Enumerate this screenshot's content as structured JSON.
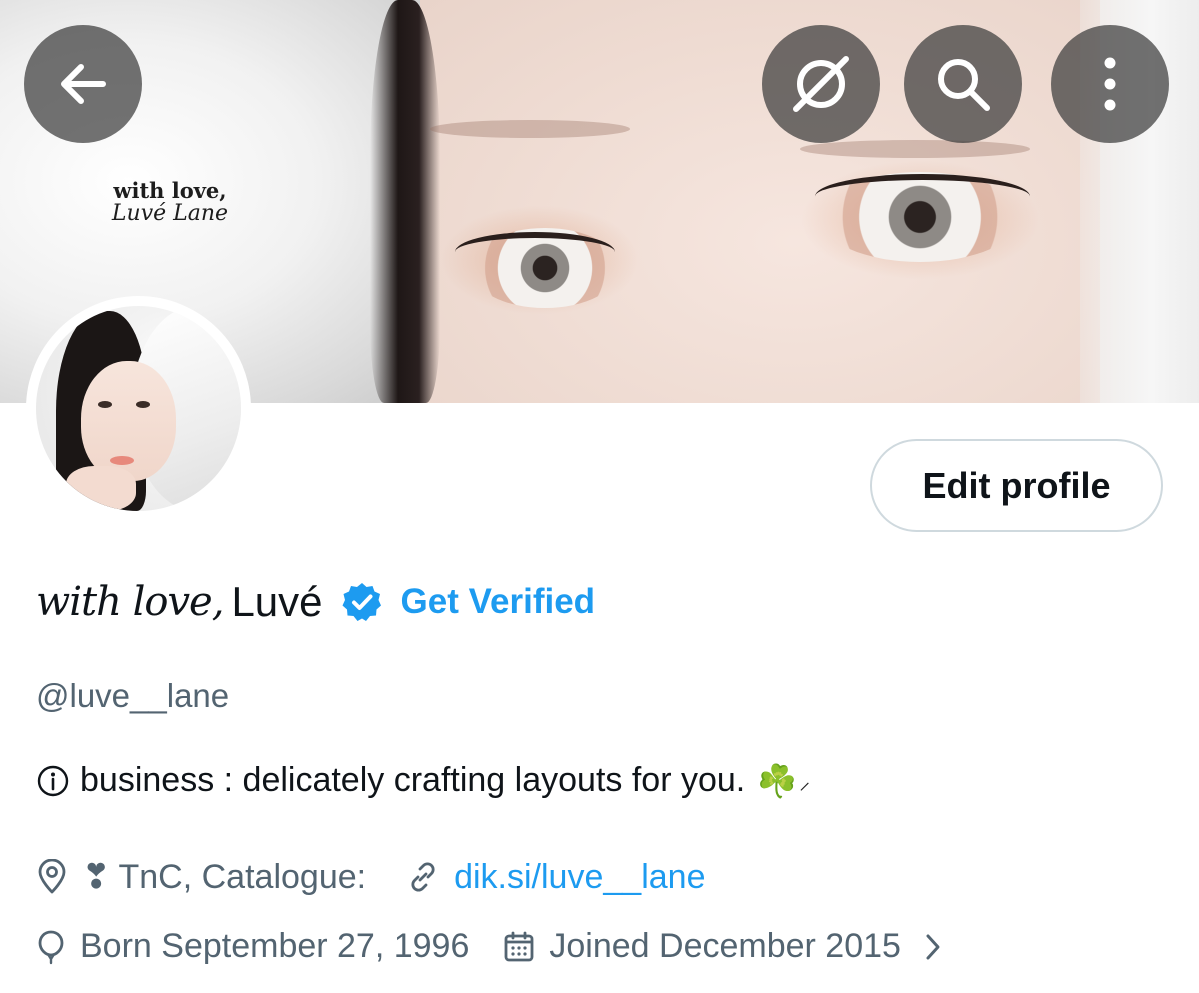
{
  "banner": {
    "signature_line1": "with love,",
    "signature_line2": "Luvé Lane"
  },
  "top_actions": {
    "back": "back-arrow-icon",
    "grok": "slash-circle-icon",
    "search": "search-icon",
    "more": "more-vertical-icon"
  },
  "profile": {
    "edit_label": "Edit profile",
    "name_italic": "with love,",
    "name_rest": "Luvé",
    "get_verified": "Get Verified",
    "handle": "@luve__lane",
    "bio_icon": "ⓘ",
    "bio_text": "business : delicately crafting layouts for you.",
    "bio_emoji": "☘️",
    "bio_sparkle": "⸝",
    "location_prefix": "❣",
    "location": "TnC, Catalogue:",
    "link": "dik.si/luve__lane",
    "born": "Born September 27, 1996",
    "joined": "Joined December 2015"
  },
  "colors": {
    "accent": "#1d9bf0",
    "secondary_text": "#536471",
    "primary_text": "#0f1419",
    "border": "#cfd9de"
  }
}
